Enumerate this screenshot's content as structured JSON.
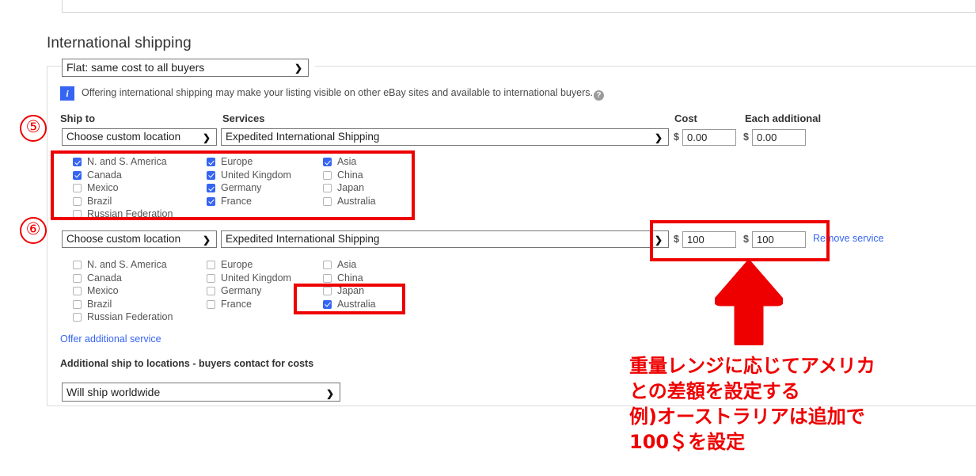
{
  "section": {
    "title": "International shipping",
    "mode_select": {
      "value": "Flat: same cost to all buyers",
      "caret": "chevron-down-icon"
    },
    "info": {
      "icon": "info-icon",
      "text": "Offering international shipping may make your listing visible on other eBay sites and available to international buyers.",
      "help_icon": "question-mark-icon"
    },
    "column_headers": {
      "ship_to": "Ship to",
      "services": "Services",
      "cost": "Cost",
      "each_additional": "Each additional"
    }
  },
  "services": [
    {
      "marker": "⑤",
      "location_select": "Choose custom location",
      "service_select": "Expedited International Shipping",
      "currency_symbol": "$",
      "cost": "0.00",
      "each_additional": "0.00",
      "remove_label": "",
      "columns": [
        [
          {
            "label": "N. and S. America",
            "checked": true
          },
          {
            "label": "Canada",
            "checked": true
          },
          {
            "label": "Mexico",
            "checked": false
          },
          {
            "label": "Brazil",
            "checked": false
          },
          {
            "label": "Russian Federation",
            "checked": false
          }
        ],
        [
          {
            "label": "Europe",
            "checked": true
          },
          {
            "label": "United Kingdom",
            "checked": true
          },
          {
            "label": "Germany",
            "checked": true
          },
          {
            "label": "France",
            "checked": true
          }
        ],
        [
          {
            "label": "Asia",
            "checked": true
          },
          {
            "label": "China",
            "checked": false
          },
          {
            "label": "Japan",
            "checked": false
          },
          {
            "label": "Australia",
            "checked": false
          }
        ]
      ]
    },
    {
      "marker": "⑥",
      "location_select": "Choose custom location",
      "service_select": "Expedited International Shipping",
      "currency_symbol": "$",
      "cost": "100",
      "each_additional": "100",
      "remove_label": "Remove service",
      "columns": [
        [
          {
            "label": "N. and S. America",
            "checked": false
          },
          {
            "label": "Canada",
            "checked": false
          },
          {
            "label": "Mexico",
            "checked": false
          },
          {
            "label": "Brazil",
            "checked": false
          },
          {
            "label": "Russian Federation",
            "checked": false
          }
        ],
        [
          {
            "label": "Europe",
            "checked": false
          },
          {
            "label": "United Kingdom",
            "checked": false
          },
          {
            "label": "Germany",
            "checked": false
          },
          {
            "label": "France",
            "checked": false
          }
        ],
        [
          {
            "label": "Asia",
            "checked": false
          },
          {
            "label": "China",
            "checked": false
          },
          {
            "label": "Japan",
            "checked": false
          },
          {
            "label": "Australia",
            "checked": true
          }
        ]
      ]
    }
  ],
  "offer_additional_service": "Offer additional service",
  "additional_locations": {
    "label": "Additional ship to locations - buyers contact for costs",
    "select_value": "Will ship worldwide",
    "caret": "chevron-down-icon"
  },
  "annotation": {
    "arrow": "up-arrow",
    "note_lines": [
      "重量レンジに応じてアメリカ",
      "との差額を設定する",
      "例)オーストラリアは追加で",
      "100＄を設定"
    ],
    "color": "#ee0000"
  }
}
